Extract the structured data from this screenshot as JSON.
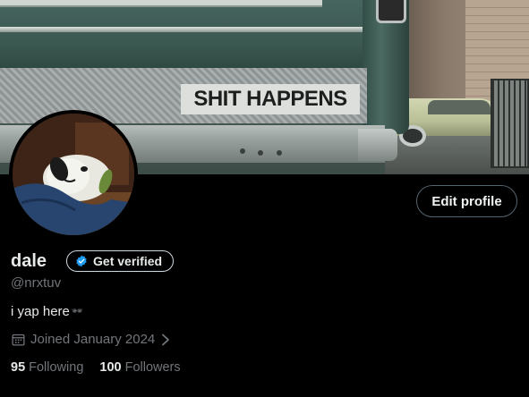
{
  "banner": {
    "sticker_text": "SHIT HAPPENS"
  },
  "profile": {
    "display_name": "dale",
    "handle": "@nrxtuv",
    "bio": "i yap here",
    "bio_emoji": "🕶",
    "joined": "Joined January 2024",
    "avatar_icon": "snoopy-sleeping-avatar"
  },
  "actions": {
    "edit_profile_label": "Edit profile",
    "get_verified_label": "Get verified"
  },
  "stats": {
    "following_count": "95",
    "following_label": "Following",
    "followers_count": "100",
    "followers_label": "Followers"
  },
  "icons": {
    "verified": "verified-badge-icon",
    "calendar": "calendar-icon",
    "chevron": "chevron-right-icon"
  },
  "colors": {
    "background": "#000000",
    "text_primary": "#e7e9ea",
    "text_secondary": "#71767b",
    "verified_blue": "#1d9bf0",
    "button_border": "#536471"
  }
}
